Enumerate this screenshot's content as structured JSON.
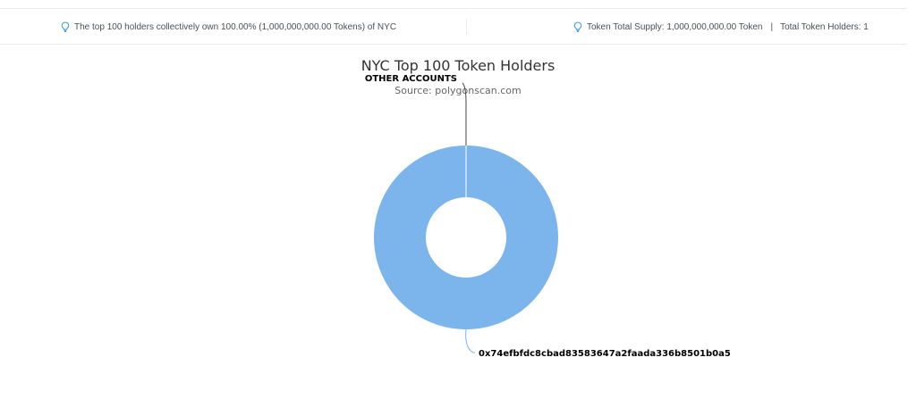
{
  "info_bar": {
    "left_text": "The top 100 holders collectively own 100.00% (1,000,000,000.00 Tokens) of NYC",
    "right_supply_text": "Token Total Supply: 1,000,000,000.00 Token",
    "separator": "|",
    "right_holders_text": "Total Token Holders: 1",
    "icon": "lightbulb-icon",
    "icon_color": "#3498db"
  },
  "chart_data": {
    "type": "pie",
    "donut": true,
    "title": "NYC Top 100 Token Holders",
    "subtitle": "Source: polygonscan.com",
    "slices": [
      {
        "label": "0x74efbfdc8cbad83583647a2faada336b8501b0a5",
        "value": 100.0,
        "color": "#7cb5ec"
      },
      {
        "label": "OTHER ACCOUNTS",
        "value": 0.0,
        "color": "#434348"
      }
    ]
  }
}
